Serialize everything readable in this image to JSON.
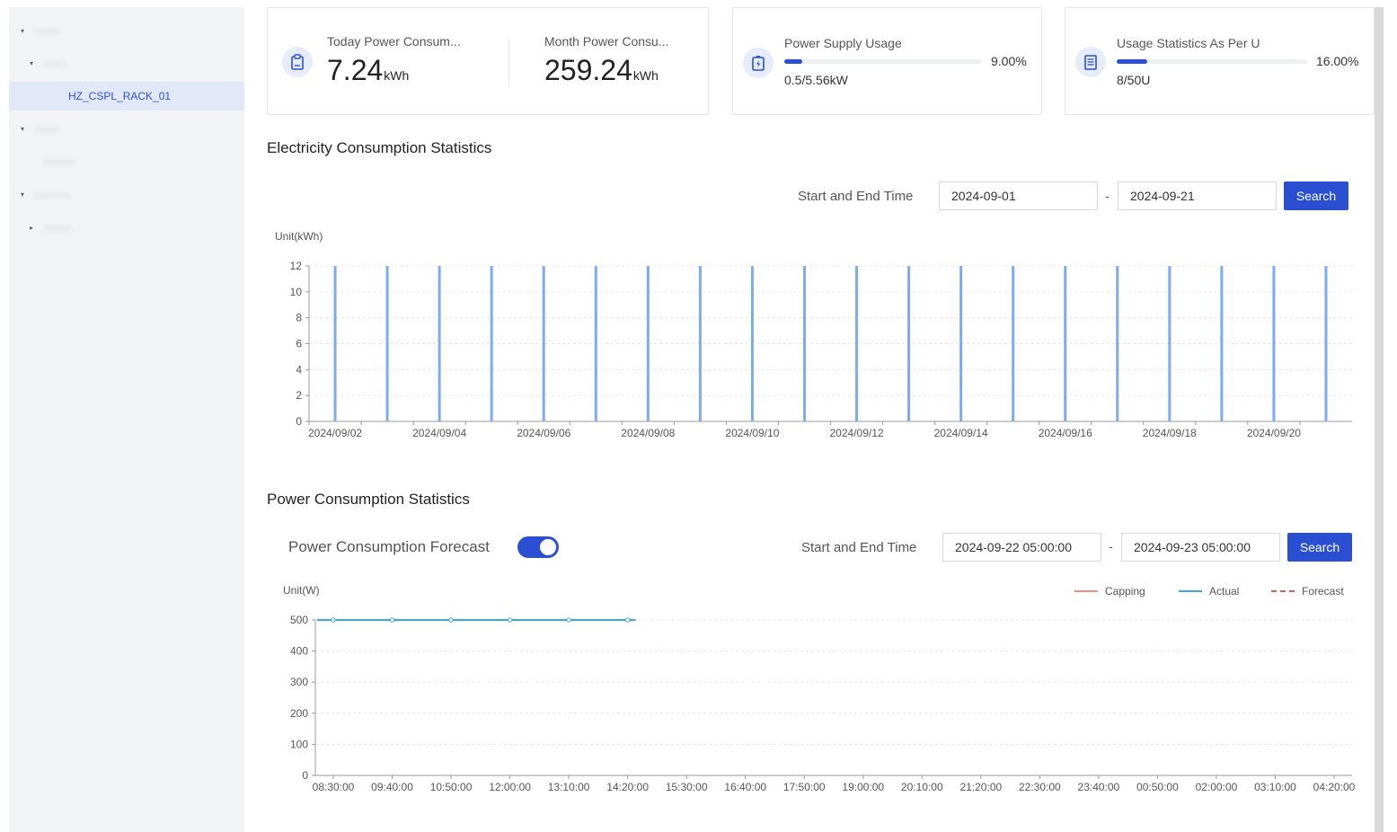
{
  "tree": [
    {
      "label": "·······",
      "depth": 0,
      "caret": "▾",
      "blurred": true
    },
    {
      "label": "······",
      "depth": 1,
      "caret": "▾",
      "blurred": true
    },
    {
      "label": "HZ_CSPL_RACK_01",
      "depth": 2,
      "caret": "",
      "blurred": false,
      "selected": true
    },
    {
      "label": "·······",
      "depth": 0,
      "caret": "▾",
      "blurred": true
    },
    {
      "label": "·········",
      "depth": 1,
      "caret": "",
      "blurred": true
    },
    {
      "label": "··········",
      "depth": 0,
      "caret": "▾",
      "blurred": true
    },
    {
      "label": "········",
      "depth": 1,
      "caret": "▸",
      "blurred": true
    }
  ],
  "cards": {
    "today": {
      "label": "Today Power Consum...",
      "value": "7.24",
      "unit": "kWh",
      "icon": "clipboard-icon"
    },
    "month": {
      "label": "Month Power Consu...",
      "value": "259.24",
      "unit": "kWh"
    },
    "supply": {
      "label": "Power Supply Usage",
      "percent": "9.00%",
      "fraction": 0.09,
      "sub": "0.5/5.56kW",
      "icon": "battery-charge-icon"
    },
    "u_usage": {
      "label": "Usage Statistics As Per U",
      "percent": "16.00%",
      "fraction": 0.16,
      "sub": "8/50U",
      "icon": "server-rack-icon"
    }
  },
  "electricity": {
    "title": "Electricity Consumption Statistics",
    "time_label": "Start and End Time",
    "start": "2024-09-01",
    "separator": "-",
    "end": "2024-09-21",
    "search_label": "Search"
  },
  "power": {
    "title": "Power Consumption Statistics",
    "forecast_label": "Power Consumption Forecast",
    "forecast_enabled": true,
    "time_label": "Start and End Time",
    "start": "2024-09-22 05:00:00",
    "separator": "-",
    "end": "2024-09-23 05:00:00",
    "search_label": "Search"
  },
  "colors": {
    "accent": "#2a4fd2",
    "bar": "#7eaaf2",
    "actual": "#3aa8d8",
    "capping": "#f09080",
    "forecast": "#e05a5a"
  },
  "chart_data": [
    {
      "type": "bar",
      "ylabel": "Unit(kWh)",
      "ylim": [
        0,
        12
      ],
      "yticks": [
        0,
        2,
        4,
        6,
        8,
        10,
        12
      ],
      "categories": [
        "2024/09/02",
        "2024/09/03",
        "2024/09/04",
        "2024/09/05",
        "2024/09/06",
        "2024/09/07",
        "2024/09/08",
        "2024/09/09",
        "2024/09/10",
        "2024/09/11",
        "2024/09/12",
        "2024/09/13",
        "2024/09/14",
        "2024/09/15",
        "2024/09/16",
        "2024/09/17",
        "2024/09/18",
        "2024/09/19",
        "2024/09/20",
        "2024/09/21"
      ],
      "tick_labels": [
        "2024/09/02",
        "2024/09/04",
        "2024/09/06",
        "2024/09/08",
        "2024/09/10",
        "2024/09/12",
        "2024/09/14",
        "2024/09/16",
        "2024/09/18",
        "2024/09/20"
      ],
      "values": [
        12,
        12,
        12,
        12,
        12,
        12,
        12,
        12,
        12,
        12,
        12,
        12,
        12,
        12,
        12,
        12,
        12,
        12,
        12,
        12
      ],
      "grid": true
    },
    {
      "type": "line",
      "ylabel": "Unit(W)",
      "ylim": [
        0,
        500
      ],
      "yticks": [
        0,
        100,
        200,
        300,
        400,
        500
      ],
      "x": [
        "08:30:00",
        "09:40:00",
        "10:50:00",
        "12:00:00",
        "13:10:00",
        "14:20:00",
        "15:30:00",
        "16:40:00",
        "17:50:00",
        "19:00:00",
        "20:10:00",
        "21:20:00",
        "22:30:00",
        "23:40:00",
        "00:50:00",
        "02:00:00",
        "03:10:00",
        "04:20:00"
      ],
      "legend": "top-right",
      "series": [
        {
          "name": "Capping",
          "values": [],
          "style": "solid"
        },
        {
          "name": "Actual",
          "values": [
            500,
            500,
            500,
            500,
            500,
            500
          ],
          "style": "solid"
        },
        {
          "name": "Forecast",
          "values": [],
          "style": "dashed"
        }
      ],
      "grid": true
    }
  ]
}
